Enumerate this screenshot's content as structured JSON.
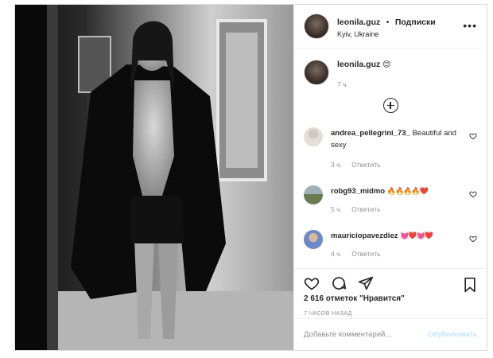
{
  "post": {
    "author": {
      "username": "leonila.guz",
      "separator": "•",
      "follow_label": "Подписки",
      "location": "Kyiv, Ukraine"
    },
    "more_icon": "more-horizontal-icon",
    "caption": {
      "username": "leonila.guz",
      "text": "😊",
      "time": "7 ч."
    },
    "load_more_icon": "plus-circle-icon",
    "comments": [
      {
        "username": "andrea_pellegrini_73_",
        "text": "Beautiful and sexy",
        "time": "3 ч.",
        "reply_label": "Ответить"
      },
      {
        "username": "robg93_midmo",
        "text": "🔥🔥🔥🔥❤️",
        "time": "5 ч.",
        "reply_label": "Ответить"
      },
      {
        "username": "mauriciopavezdiez",
        "text": "💓❤️💓❤️",
        "time": "4 ч.",
        "reply_label": "Ответить"
      }
    ],
    "actions": {
      "like_icon": "heart-icon",
      "comment_icon": "comment-icon",
      "share_icon": "send-icon",
      "save_icon": "bookmark-icon"
    },
    "likes_text": "2 616 отметок \"Нравится\"",
    "posted_ago": "7 ЧАСОВ НАЗАД",
    "add_comment": {
      "placeholder": "Добавьте комментарий...",
      "publish_label": "Опубликовать"
    }
  }
}
